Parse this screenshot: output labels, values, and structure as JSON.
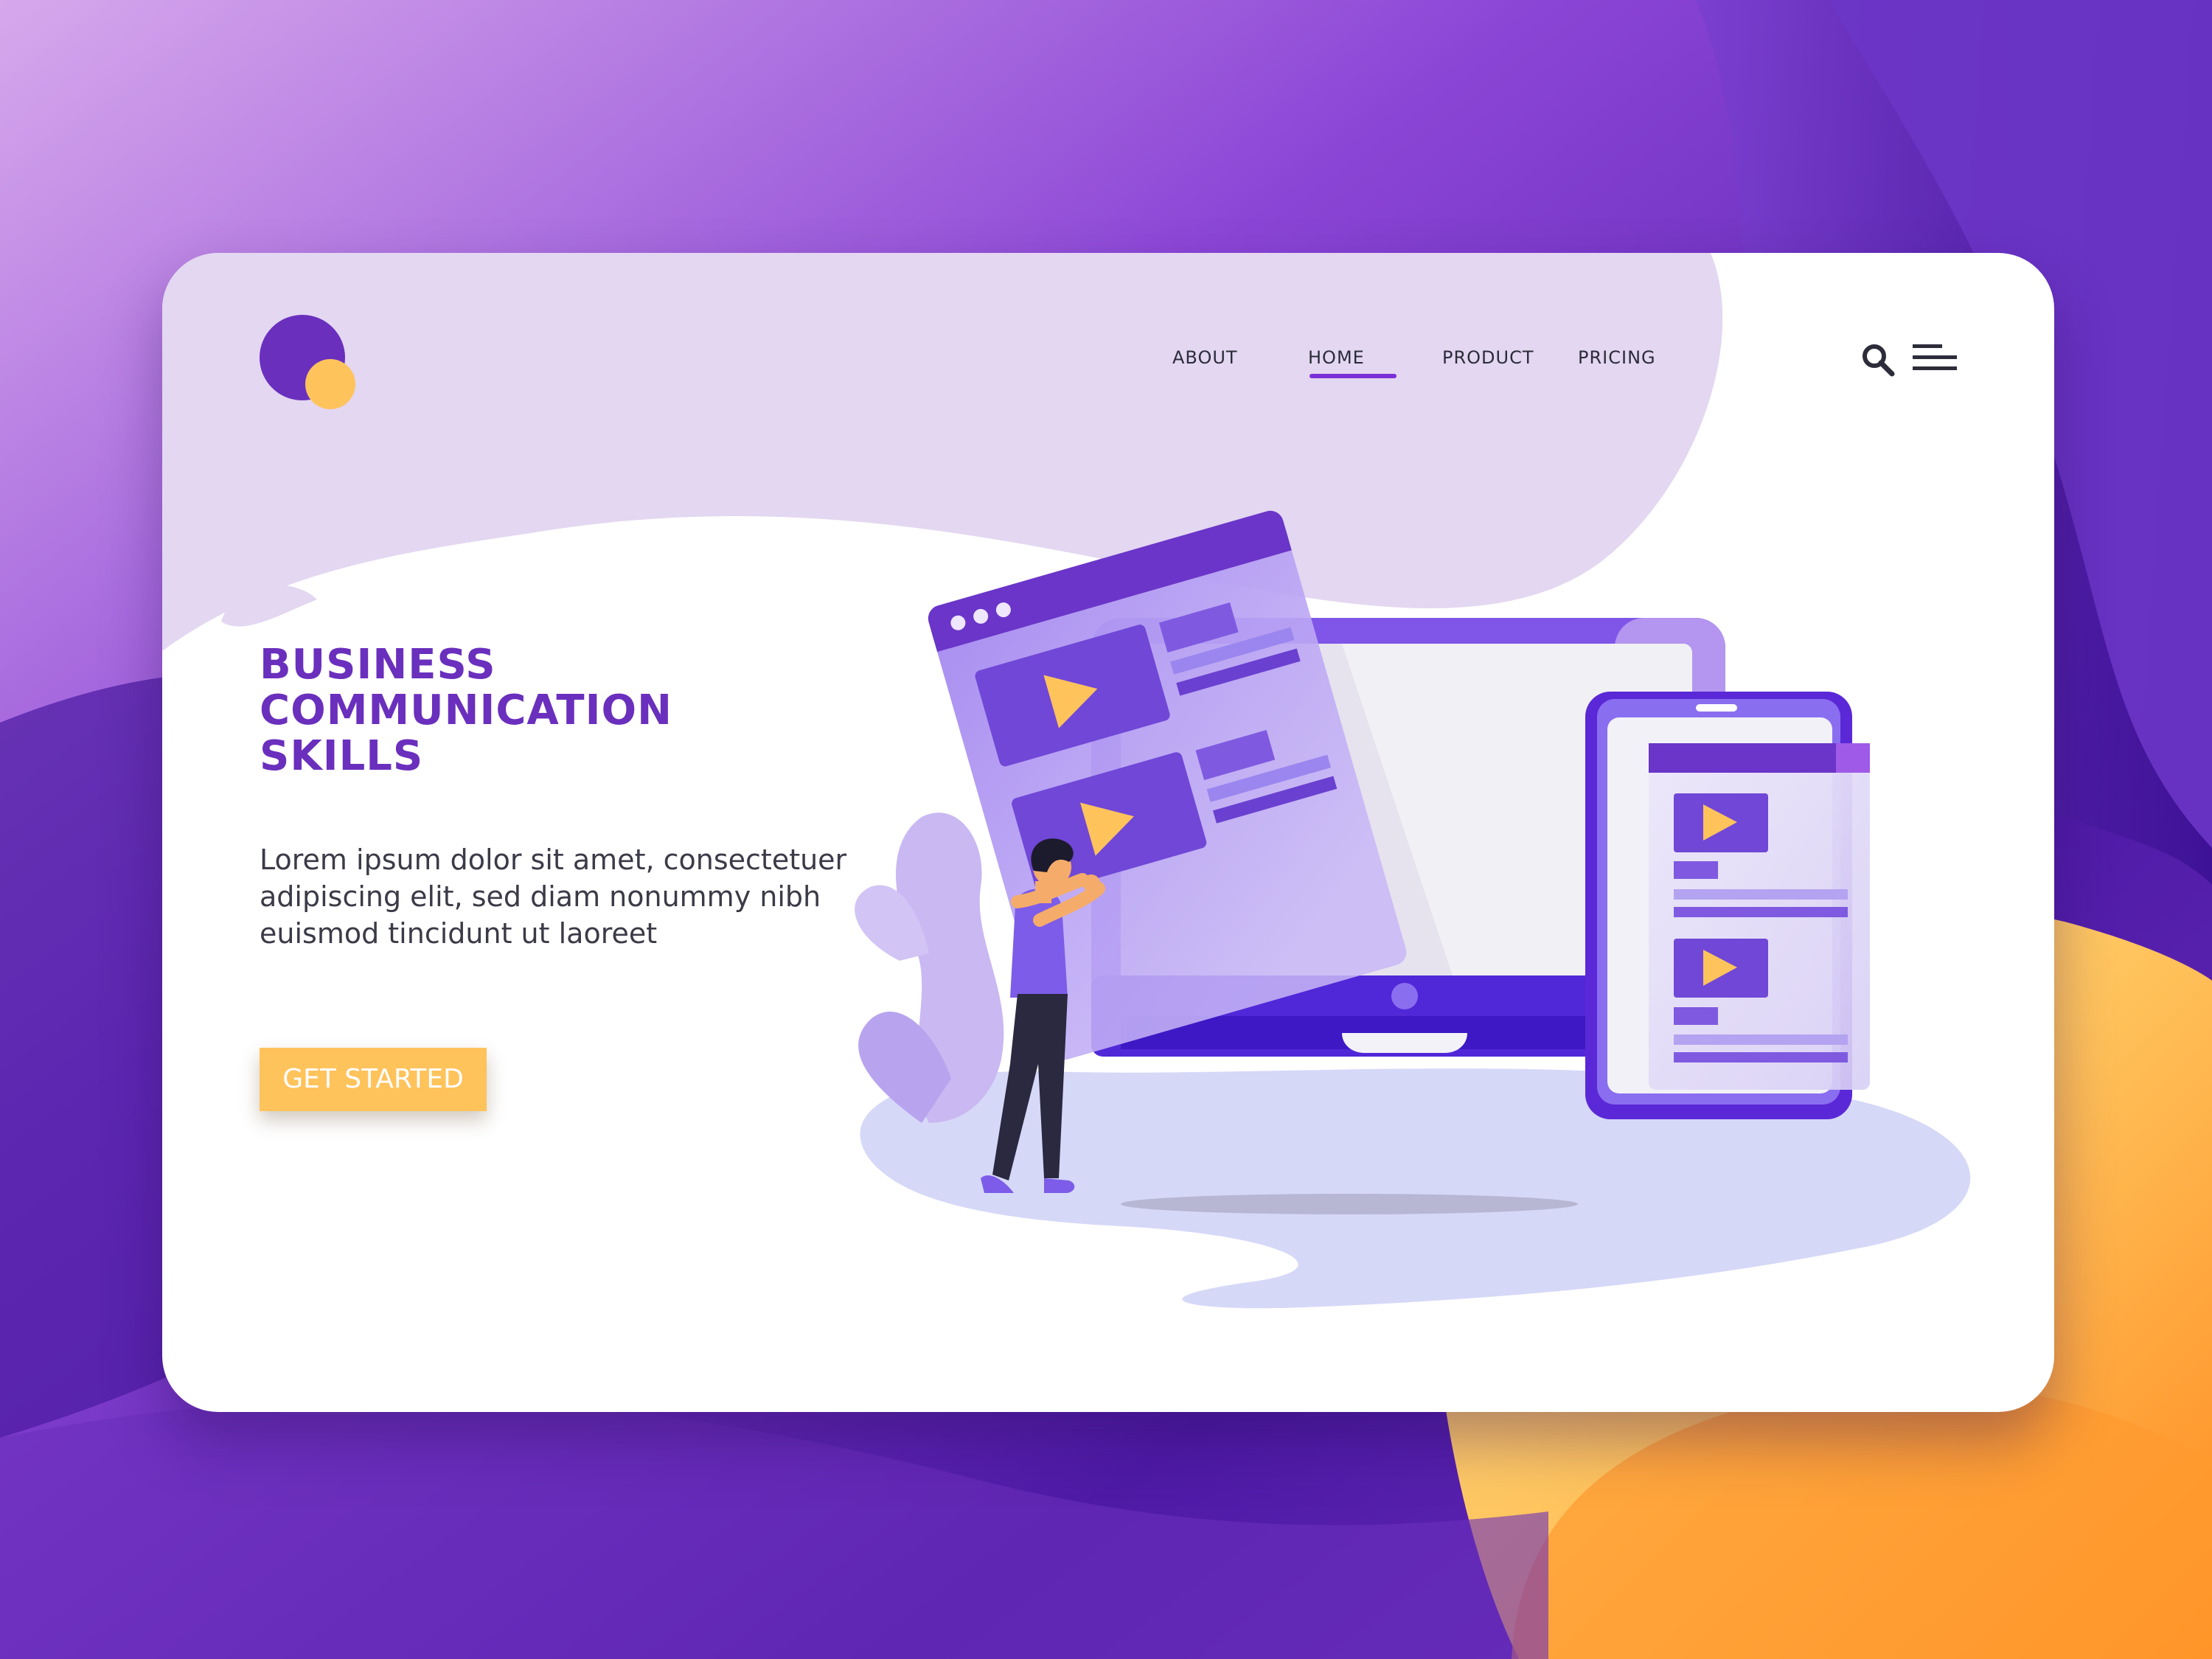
{
  "colors": {
    "brand_purple": "#6a2fbd",
    "accent_yellow": "#ffc35c",
    "text_dark": "#2c2c3a",
    "underline_purple": "#7b2fd6"
  },
  "logo": {
    "icon": "logo-icon"
  },
  "nav": {
    "items": [
      {
        "label": "ABOUT"
      },
      {
        "label": "HOME",
        "active": true
      },
      {
        "label": "PRODUCT"
      },
      {
        "label": "PRICING"
      }
    ],
    "search_icon": "search-icon",
    "menu_icon": "hamburger-menu-icon"
  },
  "hero": {
    "headline_lines": [
      "BUSINESS",
      "COMMUNICATION",
      "SKILLS"
    ],
    "body": "Lorem ipsum dolor sit amet, consectetuer adipiscing elit, sed diam nonummy nibh euismod tincidunt ut laoreet",
    "cta_label": "GET STARTED"
  }
}
